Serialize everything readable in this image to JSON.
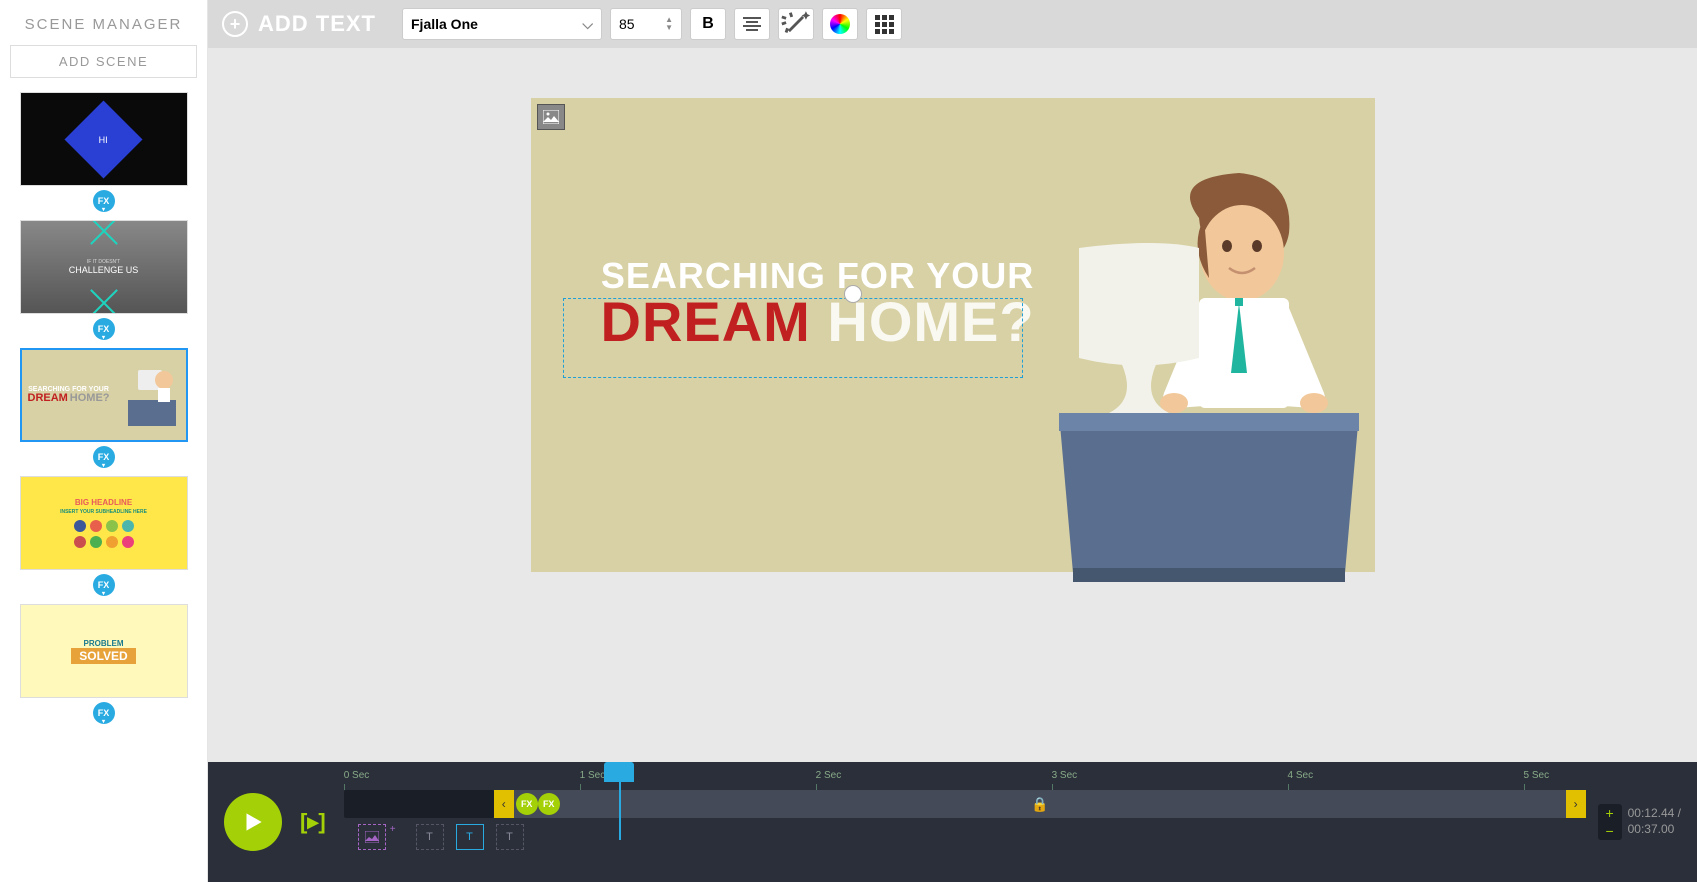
{
  "sidebar": {
    "title": "SCENE MANAGER",
    "add_scene": "ADD SCENE",
    "fx_label": "FX",
    "scenes": [
      {
        "label": "HI"
      },
      {
        "pretitle": "IF IT DOESN'T",
        "label": "CHALLENGE US"
      },
      {
        "line1": "SEARCHING FOR YOUR",
        "word1": "DREAM",
        "word2": "HOME?"
      },
      {
        "headline": "BIG HEADLINE",
        "sub": "INSERT YOUR SUBHEADLINE HERE"
      },
      {
        "word1": "PROBLEM",
        "word2": "SOLVED"
      }
    ]
  },
  "toolbar": {
    "add_text": "ADD TEXT",
    "font": "Fjalla One",
    "font_size": "85",
    "bold": "B"
  },
  "canvas": {
    "line1": "SEARCHING FOR YOUR",
    "word_red": "DREAM",
    "word_white": "HOME?"
  },
  "timeline": {
    "marks": [
      "0 Sec",
      "1 Sec",
      "2 Sec",
      "3 Sec",
      "4 Sec",
      "5 Sec"
    ],
    "fx_label": "FX",
    "t_label": "T",
    "current": "00:12.44 /",
    "total": "00:37.00"
  }
}
